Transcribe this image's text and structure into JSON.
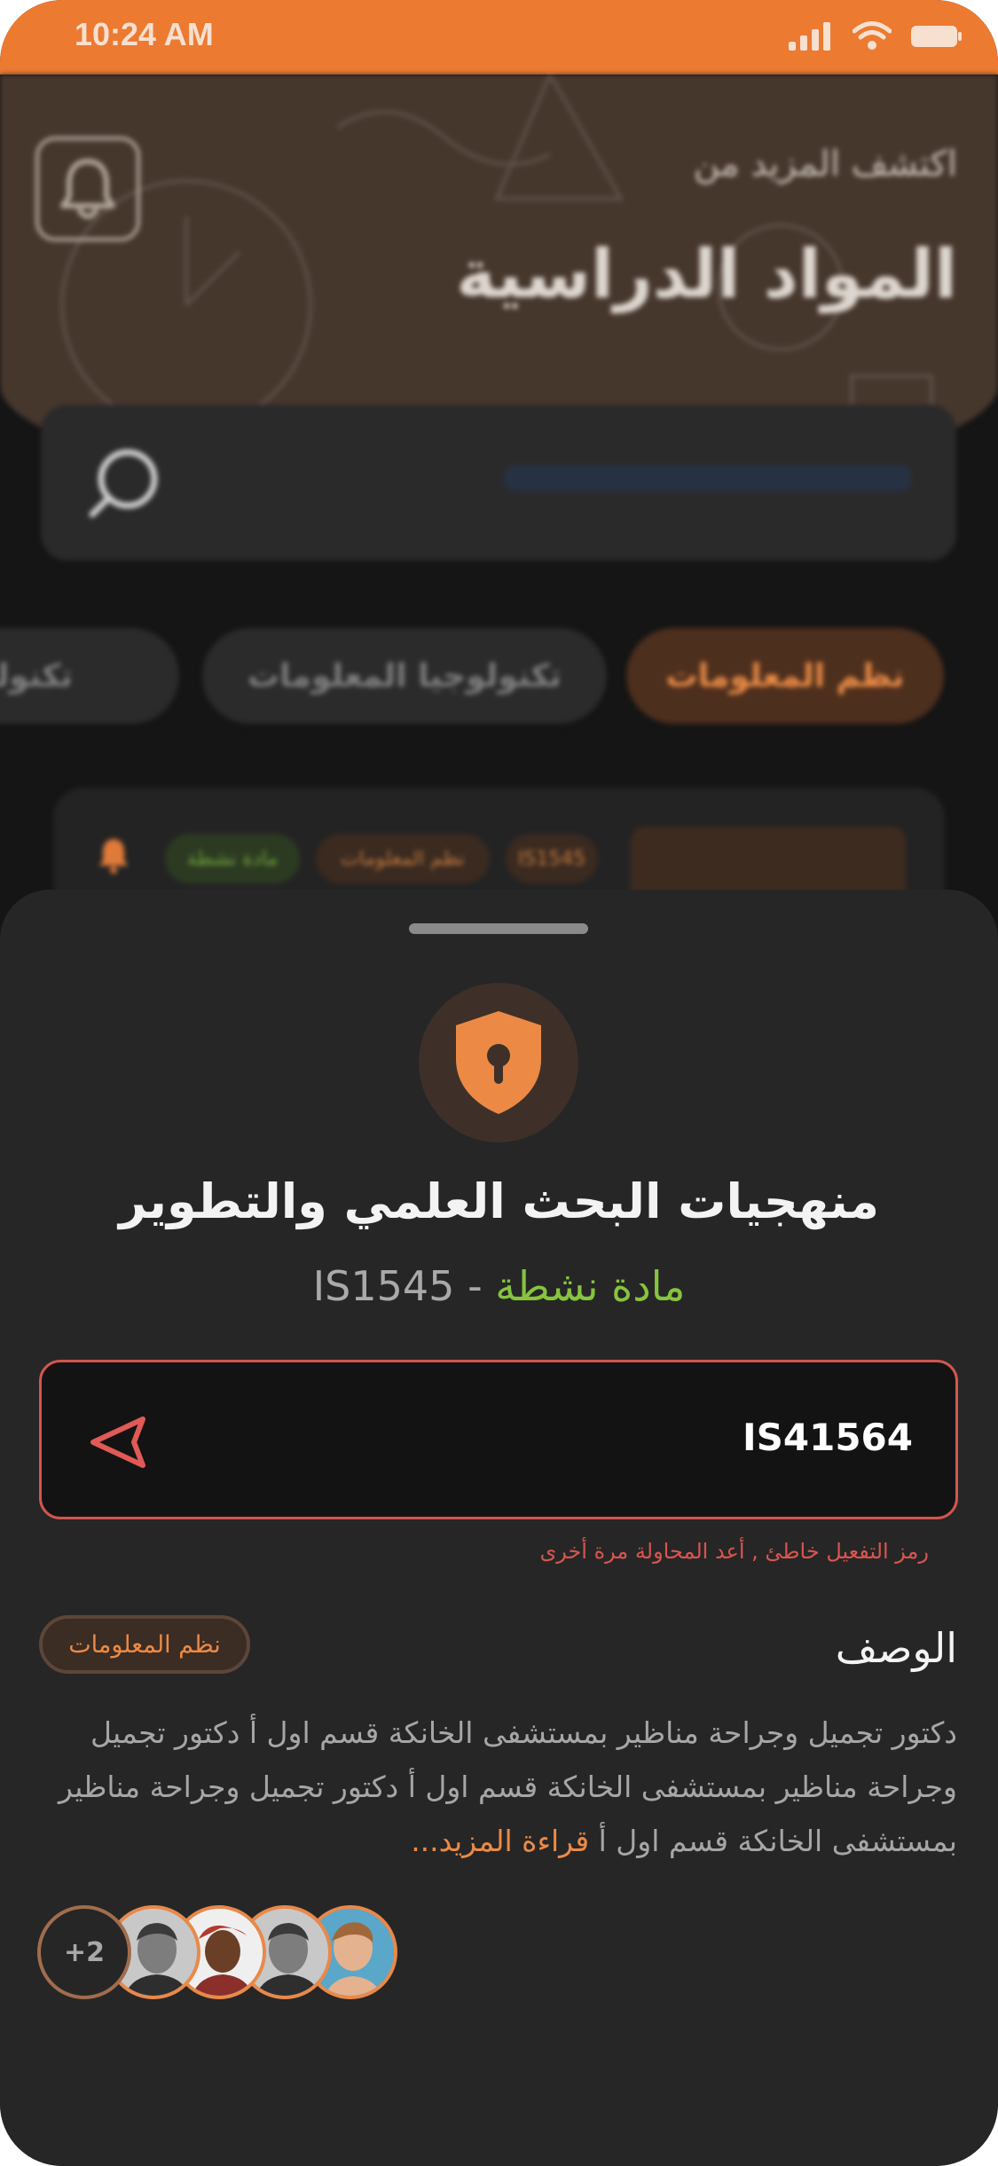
{
  "status_bar": {
    "time": "10:24 AM"
  },
  "header": {
    "subtitle": "اكتشف المزيد من",
    "title": "المواد الدراسية"
  },
  "categories": [
    {
      "label": "نظم المعلومات",
      "active": true
    },
    {
      "label": "تكنولوجيا المعلومات",
      "active": false
    },
    {
      "label": "تكنولوجيا",
      "active": false
    }
  ],
  "card_preview": {
    "tags": [
      "IS1545",
      "نظم المعلومات",
      "مادة نشطة"
    ]
  },
  "sheet": {
    "icon": "shield-lock-icon",
    "course_title": "منهجيات البحث العلمي والتطوير",
    "status": "مادة نشطة",
    "separator": "-",
    "code": "IS1545",
    "activation_input": {
      "value": "IS41564",
      "error": "رمز التفعيل خاطئ , أعد المحاولة مرة أخرى"
    },
    "description_title": "الوصف",
    "category_tag": "نظم المعلومات",
    "description": "دكتور تجميل وجراحة مناظير بمستشفى الخانكة قسم اول أ دكتور تجميل وجراحة مناظير بمستشفى الخانكة قسم اول أ دكتور تجميل وجراحة مناظير بمستشفى الخانكة قسم اول أ",
    "read_more": "قراءة المزيد...",
    "members_more": "+2"
  },
  "colors": {
    "accent": "#EC7A31",
    "active_green": "#86C43E",
    "error_red": "#D2564F",
    "sheet_bg": "#262626"
  }
}
